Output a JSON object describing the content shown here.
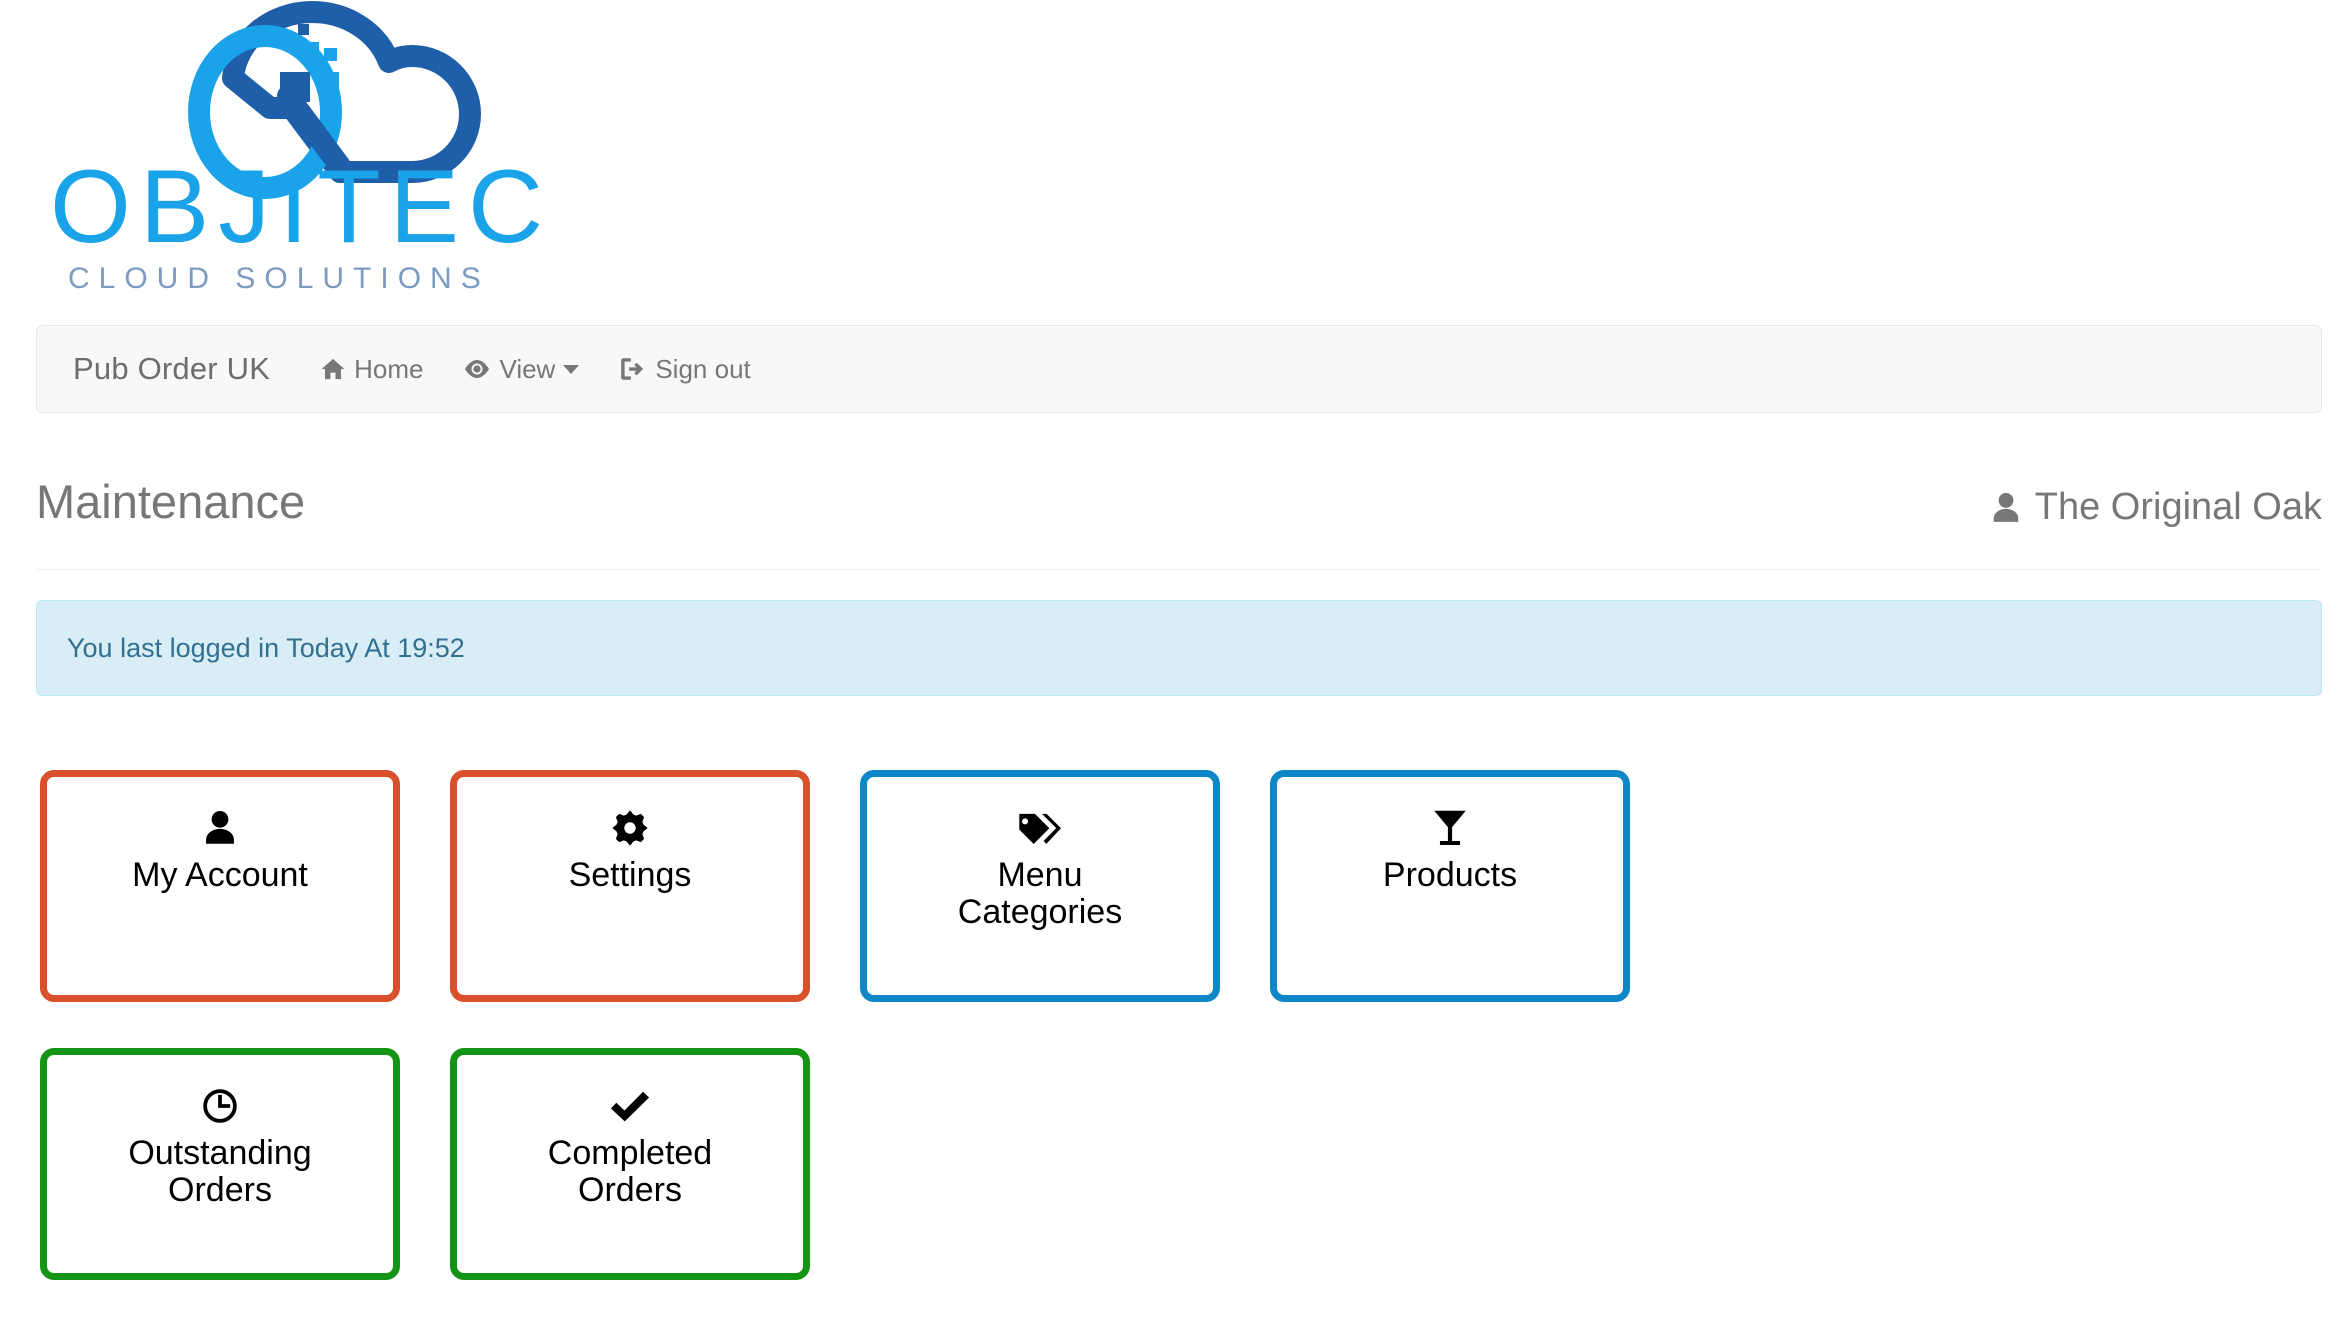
{
  "logo": {
    "wordmark": "OBJITEC",
    "tagline": "CLOUD SOLUTIONS",
    "colors": {
      "light_blue": "#1aa3e8",
      "dark_blue": "#1f5fa9",
      "tagline": "#7d9bc1"
    }
  },
  "navbar": {
    "brand": "Pub Order UK",
    "items": [
      {
        "label": "Home",
        "icon": "home-icon",
        "has_caret": false
      },
      {
        "label": "View",
        "icon": "eye-icon",
        "has_caret": true
      },
      {
        "label": "Sign out",
        "icon": "sign-out-icon",
        "has_caret": false
      }
    ]
  },
  "header": {
    "title": "Maintenance",
    "user_name": "The Original Oak",
    "user_icon": "user-icon"
  },
  "alert": {
    "message": "You last logged in Today At 19:52",
    "background": "#d9edf7",
    "border": "#bce8f1",
    "text_color": "#31708f"
  },
  "colors": {
    "orange": "#d9512c",
    "blue": "#0d87c8",
    "green": "#149314"
  },
  "tiles": {
    "rows": [
      [
        {
          "label": "My Account",
          "icon": "user-icon",
          "color": "#d9512c"
        },
        {
          "label": "Settings",
          "icon": "gear-icon",
          "color": "#d9512c"
        },
        {
          "label": "Menu\nCategories",
          "icon": "tags-icon",
          "color": "#0d87c8"
        },
        {
          "label": "Products",
          "icon": "cocktail-icon",
          "color": "#0d87c8"
        }
      ],
      [
        {
          "label": "Outstanding\nOrders",
          "icon": "clock-icon",
          "color": "#149314"
        },
        {
          "label": "Completed\nOrders",
          "icon": "check-icon",
          "color": "#149314"
        }
      ]
    ]
  }
}
